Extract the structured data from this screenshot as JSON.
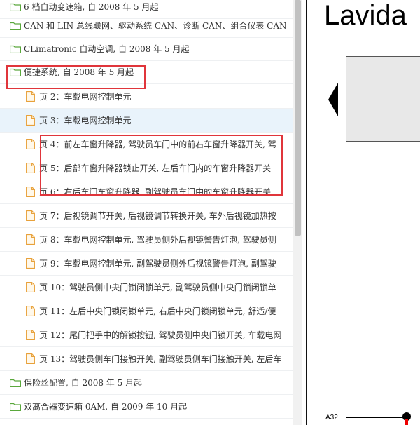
{
  "tree": {
    "rows": [
      {
        "type": "folder",
        "label": "6 档自动变速箱, 自 2008 年 5 月起",
        "highlighted": false
      },
      {
        "type": "folder",
        "label": "CAN 和 LIN 总线联网、驱动系统 CAN、诊断 CAN、组合仪表 CAN",
        "highlighted": false
      },
      {
        "type": "folder",
        "label": "CLimatronic 自动空调, 自 2008 年 5 月起",
        "highlighted": false
      },
      {
        "type": "folder",
        "label": "便捷系统, 自 2008 年 5 月起",
        "highlighted": false
      },
      {
        "type": "page",
        "label": "页 2：车载电网控制单元",
        "highlighted": false
      },
      {
        "type": "page",
        "label": "页 3：车载电网控制单元",
        "highlighted": true
      },
      {
        "type": "page",
        "label": "页 4：前左车窗升降器, 驾驶员车门中的前右车窗升降器开关, 驾",
        "highlighted": false
      },
      {
        "type": "page",
        "label": "页 5：后部车窗升降器锁止开关, 左后车门内的车窗升降器开关",
        "highlighted": false
      },
      {
        "type": "page",
        "label": "页 6：右后车门车窗升降器, 副驾驶员车门中的车窗升降器开关,",
        "highlighted": false
      },
      {
        "type": "page",
        "label": "页 7：后视镜调节开关, 后视镜调节转换开关, 车外后视镜加热按",
        "highlighted": false
      },
      {
        "type": "page",
        "label": "页 8：车载电网控制单元, 驾驶员侧外后视镜警告灯泡, 驾驶员侧",
        "highlighted": false
      },
      {
        "type": "page",
        "label": "页 9：车载电网控制单元, 副驾驶员侧外后视镜警告灯泡, 副驾驶",
        "highlighted": false
      },
      {
        "type": "page",
        "label": "页 10：驾驶员侧中央门锁闭锁单元, 副驾驶员侧中央门锁闭锁单",
        "highlighted": false
      },
      {
        "type": "page",
        "label": "页 11：左后中央门锁闭锁单元, 右后中央门锁闭锁单元, 舒适/便",
        "highlighted": false
      },
      {
        "type": "page",
        "label": "页 12：尾门把手中的解锁按钮, 驾驶员侧中央门锁开关, 车载电网",
        "highlighted": false
      },
      {
        "type": "page",
        "label": "页 13：驾驶员侧车门接触开关, 副驾驶员侧车门接触开关, 左后车",
        "highlighted": false
      },
      {
        "type": "folder",
        "label": "保险丝配置, 自 2008 年 5 月起",
        "highlighted": false
      },
      {
        "type": "folder",
        "label": "双离合器变速箱 0AM, 自 2009 年 10 月起",
        "highlighted": false
      }
    ]
  },
  "diagram": {
    "title": "Lavida",
    "connector_label": "A32"
  },
  "colors": {
    "folder_green": "#5aa83c",
    "page_orange": "#e8a13a",
    "highlight_bg": "#e9f3fb",
    "annotation_red": "#e0353b"
  }
}
